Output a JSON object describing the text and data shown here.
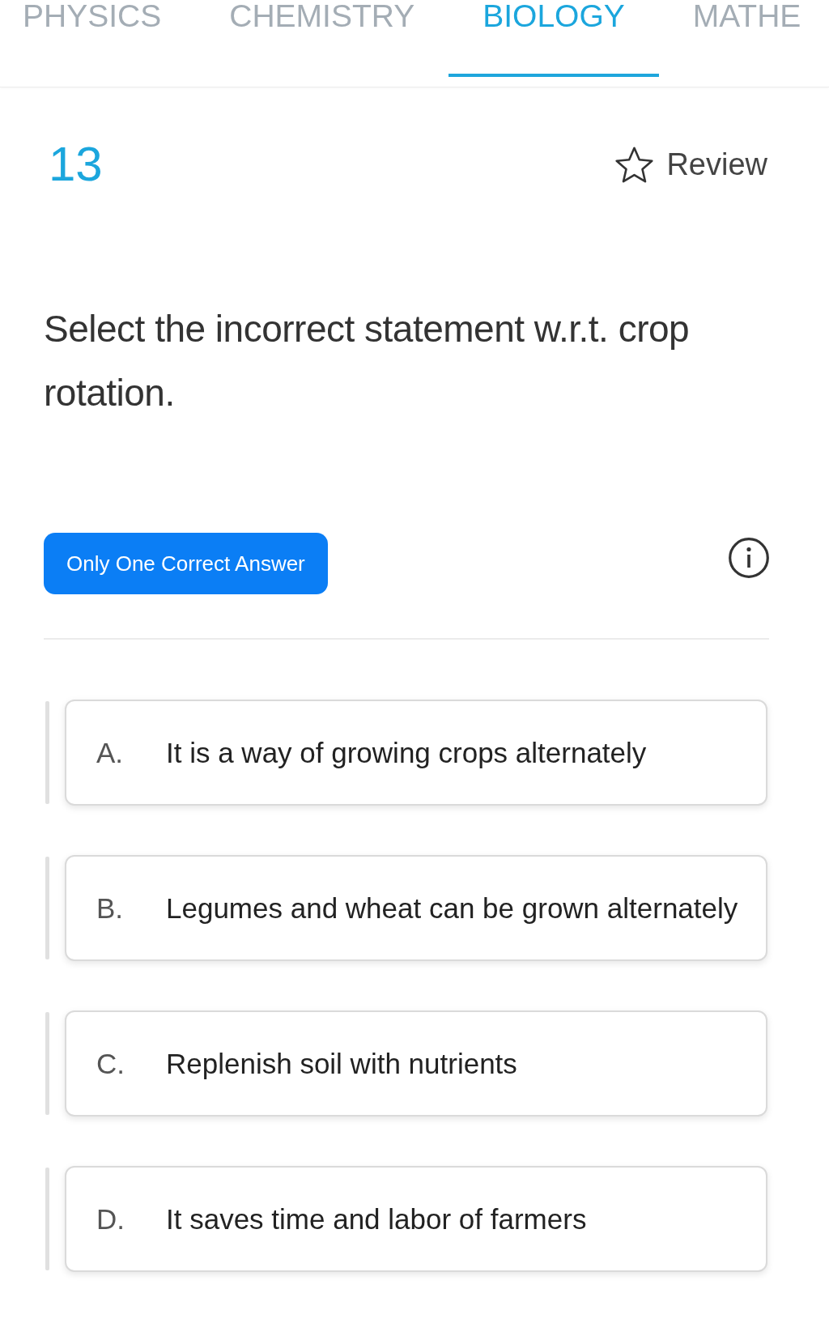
{
  "tabs": [
    {
      "label": "PHYSICS",
      "selected": false
    },
    {
      "label": "CHEMISTRY",
      "selected": false
    },
    {
      "label": "BIOLOGY",
      "selected": true
    },
    {
      "label": "MATHE",
      "selected": false
    }
  ],
  "question": {
    "number": "13",
    "review": {
      "label": "Review",
      "marked": false
    },
    "text": "Select the incorrect statement w.r.t. crop rotation.",
    "answer_type": "Only One Correct Answer"
  },
  "options": [
    {
      "letter": "A.",
      "text": "It is a way of growing crops alternately",
      "selected": false
    },
    {
      "letter": "B.",
      "text": "Legumes and wheat can be grown alternately",
      "selected": false
    },
    {
      "letter": "C.",
      "text": "Replenish soil with nutrients",
      "selected": false
    },
    {
      "letter": "D.",
      "text": "It saves time and labor of farmers",
      "selected": false
    }
  ]
}
